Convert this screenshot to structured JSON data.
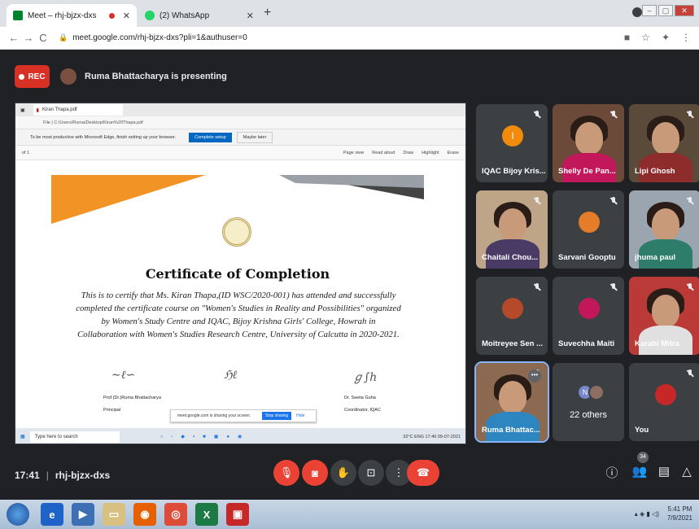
{
  "browser": {
    "tabs": [
      {
        "title": "Meet – rhj-bjzx-dxs",
        "favicon_color": "#00832d",
        "recording": true
      },
      {
        "title": "(2) WhatsApp",
        "favicon_color": "#25d366",
        "recording": false
      }
    ],
    "new_tab": "+",
    "address": "meet.google.com/rhj-bjzx-dxs?pli=1&authuser=0",
    "window_controls": [
      "–",
      "▢",
      "✕"
    ]
  },
  "meet": {
    "rec_label": "REC",
    "presenting_text": "Ruma Bhattacharya is presenting",
    "meeting_time": "17:41",
    "meeting_code": "rhj-bjzx-dxs",
    "participant_count": "34",
    "participants": [
      {
        "name": "IQAC Bijoy Kris...",
        "type": "avatar",
        "initial": "I",
        "color": "#f28b0c"
      },
      {
        "name": "Shelly De Pan...",
        "type": "video",
        "bg": "#6b4a3a",
        "shirt": "#c2185b"
      },
      {
        "name": "Lipi Ghosh",
        "type": "video",
        "bg": "#5a4a3a",
        "shirt": "#8e2c2c"
      },
      {
        "name": "Chaitali Chou...",
        "type": "video",
        "bg": "#bfa588",
        "shirt": "#4a3a66"
      },
      {
        "name": "Sarvani Gooptu",
        "type": "avatar-photo",
        "color": "#e57c2a"
      },
      {
        "name": "jhuma paul",
        "type": "video",
        "bg": "#9aa5b0",
        "shirt": "#2e7d6a"
      },
      {
        "name": "Moitreyee Sen ...",
        "type": "avatar-photo",
        "color": "#b44a2a"
      },
      {
        "name": "Suvechha Maiti",
        "type": "avatar-photo",
        "color": "#c2185b"
      },
      {
        "name": "Karabi Mitra",
        "type": "video",
        "bg": "#b93a36",
        "shirt": "#e0e0e0"
      },
      {
        "name": "Ruma Bhattac...",
        "type": "video",
        "bg": "#8c6a52",
        "shirt": "#2e86c1",
        "highlight": true
      },
      {
        "name": "22 others",
        "type": "others"
      },
      {
        "name": "You",
        "type": "avatar-photo",
        "color": "#c62828"
      }
    ]
  },
  "shared_screen": {
    "tab_title": "Kiran Thapa.pdf",
    "address": "File | C:/Users/Ruma/Desktop/Kiran%20Thapa.pdf",
    "infobar_text": "To be most productive with Microsoft Edge, finish setting up your browser.",
    "infobar_button": "Complete setup",
    "infobar_later": "Maybe later",
    "page_number": "of 1",
    "pdf_tools": [
      "Page view",
      "Read aloud",
      "Draw",
      "Highlight",
      "Erase"
    ],
    "certificate": {
      "title": "Certificate of Completion",
      "body": "This is to certify that Ms. Kiran Thapa,(ID WSC/2020-001) has attended and successfully completed the certificate course on \"Women's Studies in Reality and Possibilities\" organized by Women's Study Centre and IQAC, Bijoy Krishna Girls' College, Howrah in Collaboration with Women's Studies Research Centre, University of Calcutta in 2020-2021.",
      "sign_left_name": "Prof.(Dr.)Ruma Bhattacharya",
      "sign_left_role": "Principal",
      "sign_right_name": "Dr. Sweta Guha",
      "sign_right_role": "Coordinator, IQAC"
    },
    "share_notice": "meet.google.com is sharing your screen.",
    "share_stop": "Stop sharing",
    "share_hide": "Hide",
    "taskbar_search": "Type here to search",
    "taskbar_tray": "32°C  ENG  17:40 09-07-2021"
  },
  "os_taskbar": {
    "time": "5:41 PM",
    "date": "7/9/2021"
  }
}
